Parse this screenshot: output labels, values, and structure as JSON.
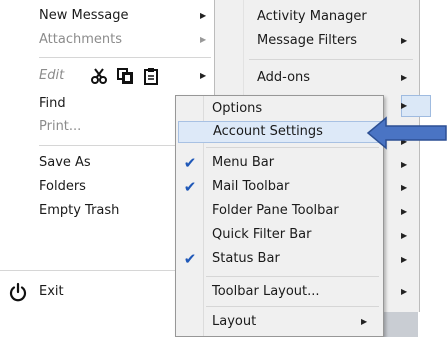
{
  "main_menu": {
    "new_message": "New Message",
    "attachments": "Attachments",
    "edit": "Edit",
    "find": "Find",
    "print": "Print...",
    "save_as": "Save As",
    "folders": "Folders",
    "empty_trash": "Empty Trash",
    "exit": "Exit",
    "edit_icons": [
      "scissors-icon",
      "copy-icon",
      "paste-icon"
    ]
  },
  "tools_menu": {
    "activity_manager": "Activity Manager",
    "message_filters": "Message Filters",
    "addons": "Add-ons"
  },
  "submenu": {
    "options": "Options",
    "account_settings": "Account Settings",
    "menu_bar": "Menu Bar",
    "mail_toolbar": "Mail Toolbar",
    "folder_pane_toolbar": "Folder Pane Toolbar",
    "quick_filter_bar": "Quick Filter Bar",
    "status_bar": "Status Bar",
    "toolbar_layout": "Toolbar Layout...",
    "layout": "Layout",
    "checked": [
      "menu_bar",
      "mail_toolbar",
      "status_bar"
    ],
    "highlighted": "account_settings"
  },
  "colors": {
    "menu_bg": "#f0f0f0",
    "highlight": "#dde9f8",
    "check": "#1f58b8",
    "callout_arrow": "#4a74c4"
  }
}
